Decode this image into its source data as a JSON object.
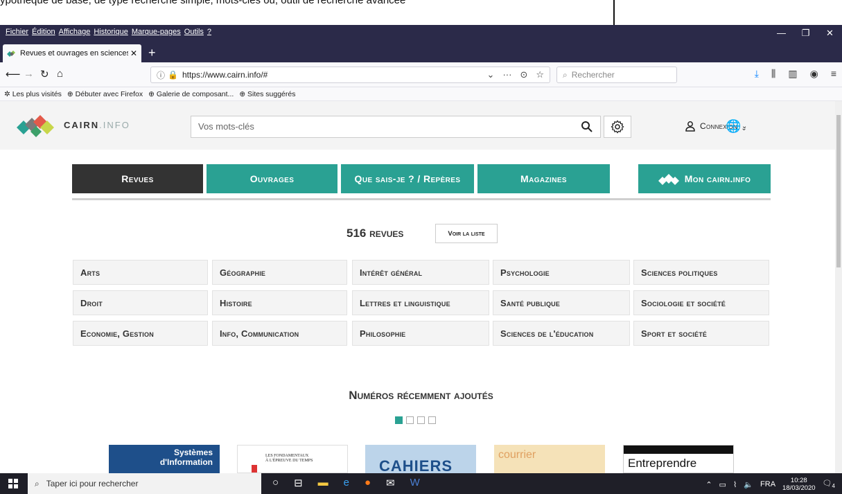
{
  "doc_caption": "ypothèque de base, de type recherche simple, mots-clés ou, outil de recherche avancée",
  "browser": {
    "menu": [
      "Fichier",
      "Édition",
      "Affichage",
      "Historique",
      "Marque-pages",
      "Outils",
      "?"
    ],
    "tab_title": "Revues et ouvrages en sciences",
    "url": "https://www.cairn.info/#",
    "search_placeholder": "Rechercher",
    "bookmarks": [
      "Les plus visités",
      "Débuter avec Firefox",
      "Galerie de composant...",
      "Sites suggérés"
    ]
  },
  "header": {
    "logo_main": "CAIRN",
    "logo_sep": ".",
    "logo_info": "INFO",
    "search_placeholder": "Vos mots-clés",
    "login_label": "Connexion"
  },
  "nav": {
    "revues": "Revues",
    "ouvrages": "Ouvrages",
    "que_sais_je": "Que sais-je ? / Repères",
    "magazines": "Magazines",
    "mon_cairn": "Mon cairn.info"
  },
  "revues": {
    "count_label": "516 revues",
    "voir_liste": "Voir la liste"
  },
  "disciplines": [
    [
      "Arts",
      "Géographie",
      "Intérêt général",
      "Psychologie",
      "Sciences politiques"
    ],
    [
      "Droit",
      "Histoire",
      "Lettres et linguistique",
      "Santé publique",
      "Sociologie et société"
    ],
    [
      "Economie, Gestion",
      "Info, Communication",
      "Philosophie",
      "Sciences de l'éducation",
      "Sport et société"
    ]
  ],
  "recent": {
    "title": "Numéros récemment ajoutés",
    "covers": [
      {
        "line1": "Systèmes",
        "line2": "d'Information"
      },
      {
        "line1": "LES FONDAMENTAUX",
        "line2": "À L'ÉPREUVE DU TEMPS"
      },
      {
        "line1": "CAHIERS DE"
      },
      {
        "line1": "courrier"
      },
      {
        "line1": "Entreprendre"
      }
    ]
  },
  "taskbar": {
    "search_placeholder": "Taper ici pour rechercher",
    "lang": "FRA",
    "time": "10:28",
    "date": "18/03/2020",
    "notif": "4"
  },
  "colors": {
    "teal": "#2aa193",
    "dark": "#333333",
    "browser_frame": "#2b2a49"
  }
}
